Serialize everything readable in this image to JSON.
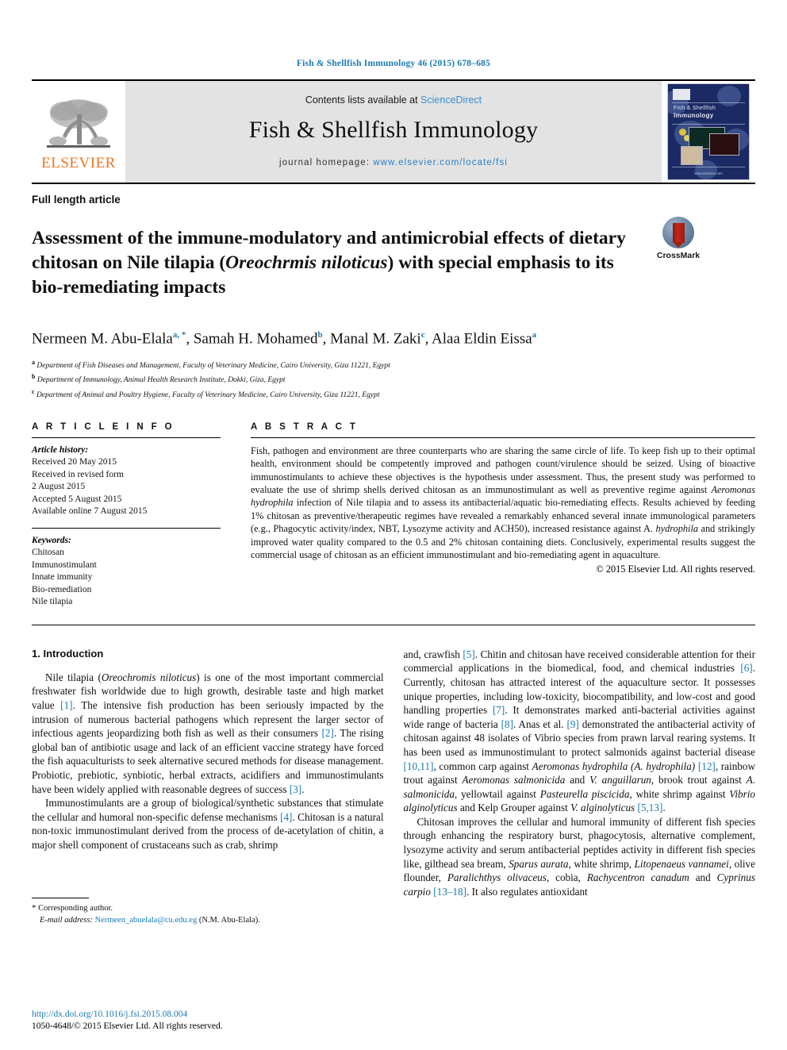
{
  "running_head": "Fish & Shellfish Immunology 46 (2015) 678–685",
  "masthead": {
    "publisher_name": "ELSEVIER",
    "contents_prefix": "Contents lists available at ",
    "sciencedirect": "ScienceDirect",
    "journal_title": "Fish & Shellfish Immunology",
    "homepage_prefix": "journal homepage: ",
    "homepage_url": "www.elsevier.com/locate/fsi",
    "cover": {
      "title_line1": "Fish & Shellfish",
      "title_line2": "Immunology",
      "bottom_url": "www.elsevier.com"
    }
  },
  "article": {
    "type": "Full length article",
    "title_part1": "Assessment of the immune-modulatory and antimicrobial effects of dietary chitosan on Nile tilapia (",
    "title_italic": "Oreochrmis niloticus",
    "title_part2": ") with special emphasis to its bio-remediating impacts",
    "crossmark_label": "CrossMark"
  },
  "authors": {
    "list": "Nermeen M. Abu-Elala , Samah H. Mohamed , Manal M. Zaki , Alaa Eldin Eissa",
    "a1": "Nermeen M. Abu-Elala",
    "a1_sup": "a, *",
    "a2": "Samah H. Mohamed",
    "a2_sup": "b",
    "a3": "Manal M. Zaki",
    "a3_sup": "c",
    "a4": "Alaa Eldin Eissa",
    "a4_sup": "a",
    "affiliations": [
      {
        "mark": "a",
        "text": "Department of Fish Diseases and Management, Faculty of Veterinary Medicine, Cairo University, Giza 11221, Egypt"
      },
      {
        "mark": "b",
        "text": "Department of Immunology, Animal Health Research Institute, Dokki, Giza, Egypt"
      },
      {
        "mark": "c",
        "text": "Department of Animal and Poultry Hygiene, Faculty of Veterinary Medicine, Cairo University, Giza 11221, Egypt"
      }
    ]
  },
  "article_info": {
    "heading": "A R T I C L E  I N F O",
    "history_label": "Article history:",
    "history": [
      "Received 20 May 2015",
      "Received in revised form",
      "2 August 2015",
      "Accepted 5 August 2015",
      "Available online 7 August 2015"
    ],
    "keywords_label": "Keywords:",
    "keywords": [
      "Chitosan",
      "Immunostimulant",
      "Innate immunity",
      "Bio-remediation",
      "Nile tilapia"
    ]
  },
  "abstract": {
    "heading": "A B S T R A C T",
    "p1": "Fish, pathogen and environment are three counterparts who are sharing the same circle of life. To keep fish up to their optimal health, environment should be competently improved and pathogen count/virulence should be seized. Using of bioactive immunostimulants to achieve these objectives is the hypothesis under assessment. Thus, the present study was performed to evaluate the use of shrimp shells derived chitosan as an immunostimulant as well as preventive regime against ",
    "p1_italic1": "Aeromonas hydrophila",
    "p2": " infection of Nile tilapia and to assess its antibacterial/aquatic bio-remediating effects. Results achieved by feeding 1% chitosan as preventive/therapeutic regimes have revealed a remarkably enhanced several innate immunological parameters (e.g., Phagocytic activity/index, NBT, Lysozyme activity and ACH50), increased resistance against A. ",
    "p2_italic": "hydrophila",
    "p3": " and strikingly improved water quality compared to the 0.5 and 2% chitosan containing diets. Conclusively, experimental results suggest the commercial usage of chitosan as an efficient immunostimulant and bio-remediating agent in aquaculture.",
    "copyright": "© 2015 Elsevier Ltd. All rights reserved."
  },
  "body": {
    "section_heading": "1. Introduction",
    "left": {
      "p1_a": "Nile tilapia (",
      "p1_i1": "Oreochromis niloticus",
      "p1_b": ") is one of the most important commercial freshwater fish worldwide due to high growth, desirable taste and high market value ",
      "p1_r1": "[1]",
      "p1_c": ". The intensive fish production has been seriously impacted by the intrusion of numerous bacterial pathogens which represent the larger sector of infectious agents jeopardizing both fish as well as their consumers ",
      "p1_r2": "[2]",
      "p1_d": ". The rising global ban of antibiotic usage and lack of an efficient vaccine strategy have forced the fish aquaculturists to seek alternative secured methods for disease management. Probiotic, prebiotic, synbiotic, herbal extracts, acidifiers and immunostimulants have been widely applied with reasonable degrees of success ",
      "p1_r3": "[3]",
      "p1_e": ".",
      "p2_a": "Immunostimulants are a group of biological/synthetic substances that stimulate the cellular and humoral non-specific defense mechanisms ",
      "p2_r1": "[4]",
      "p2_b": ". Chitosan is a natural non-toxic immunostimulant derived from the process of de-acetylation of chitin, a major shell component of crustaceans such as crab, shrimp"
    },
    "right": {
      "p1_a": "and, crawfish ",
      "p1_r1": "[5]",
      "p1_b": ". Chitin and chitosan have received considerable attention for their commercial applications in the biomedical, food, and chemical industries ",
      "p1_r2": "[6]",
      "p1_c": ". Currently, chitosan has attracted interest of the aquaculture sector. It possesses unique properties, including low-toxicity, biocompatibility, and low-cost and good handling properties ",
      "p1_r3": "[7]",
      "p1_d": ". It demonstrates marked anti-bacterial activities against wide range of bacteria ",
      "p1_r4": "[8]",
      "p1_e": ". Anas et al. ",
      "p1_r5": "[9]",
      "p1_f": " demonstrated the antibacterial activity of chitosan against 48 isolates of Vibrio species from prawn larval rearing systems. It has been used as immunostimulant to protect salmonids against bacterial disease ",
      "p1_r6": "[10,11]",
      "p1_g": ", common carp against ",
      "p1_i1": "Aeromonas hydrophila (A. hydrophila)",
      "p1_h": " ",
      "p1_r7": "[12]",
      "p1_j": ", rainbow trout against ",
      "p1_i2": "Aeromonas salmonicida",
      "p1_k": " and ",
      "p1_i3": "V. anguillarun",
      "p1_l": ", brook trout against ",
      "p1_i4": "A. salmonicida",
      "p1_m": ", yellowtail against ",
      "p1_i5": "Pasteurella piscicida",
      "p1_n": ", white shrimp against ",
      "p1_i6": "Vibrio alginolyticus",
      "p1_o": " and Kelp Grouper against ",
      "p1_i7": "V. alginolyticus",
      "p1_p": " ",
      "p1_r8": "[5,13]",
      "p1_q": ".",
      "p2_a": "Chitosan improves the cellular and humoral immunity of different fish species through enhancing the respiratory burst, phagocytosis, alternative complement, lysozyme activity and serum antibacterial peptides activity in different fish species like, gilthead sea bream, ",
      "p2_i1": "Sparus aurata",
      "p2_b": ", white shrimp, ",
      "p2_i2": "Litopenaeus vannamei",
      "p2_c": ", olive flounder, ",
      "p2_i3": "Paralichthys olivaceus",
      "p2_d": ", cobia, ",
      "p2_i4": "Rachycentron canadum",
      "p2_e": " and ",
      "p2_i5": "Cyprinus carpio",
      "p2_f": " ",
      "p2_r1": "[13–18]",
      "p2_g": ". It also regulates antioxidant"
    }
  },
  "footnote": {
    "star": "*",
    "corresponding": " Corresponding author.",
    "email_label": "E-mail address:",
    "email": "Nermeen_abuelala@cu.edu.eg",
    "email_owner": "(N.M. Abu-Elala)."
  },
  "page_footer": {
    "doi": "http://dx.doi.org/10.1016/j.fsi.2015.08.004",
    "issn_line": "1050-4648/© 2015 Elsevier Ltd. All rights reserved."
  },
  "colors": {
    "accent_blue": "#1a7ab5",
    "link_blue": "#3a8fd0",
    "elsevier_orange": "#E87722",
    "masthead_gray": "#e3e3e3",
    "cover_navy": "#1b2a63",
    "crossmark_red": "#c3281a"
  }
}
